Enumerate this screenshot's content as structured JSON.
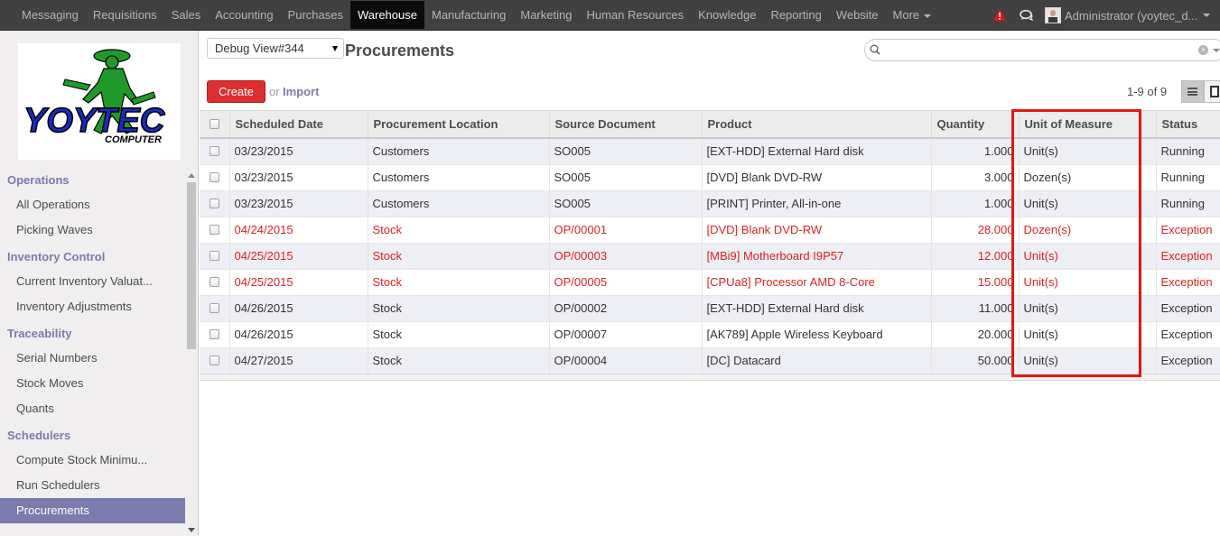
{
  "topbar": {
    "menu": [
      "Messaging",
      "Requisitions",
      "Sales",
      "Accounting",
      "Purchases",
      "Warehouse",
      "Manufacturing",
      "Marketing",
      "Human Resources",
      "Knowledge",
      "Reporting",
      "Website",
      "More"
    ],
    "active": "Warehouse",
    "user_name": "Administrator (yoytec_d..."
  },
  "sidebar": {
    "logo_text": "YOYTEC",
    "logo_subtext": "COMPUTER",
    "sections": [
      {
        "title": "Operations",
        "items": [
          "All Operations",
          "Picking Waves"
        ]
      },
      {
        "title": "Inventory Control",
        "items": [
          "Current Inventory Valuat...",
          "Inventory Adjustments"
        ]
      },
      {
        "title": "Traceability",
        "items": [
          "Serial Numbers",
          "Stock Moves",
          "Quants"
        ]
      },
      {
        "title": "Schedulers",
        "items": [
          "Compute Stock Minimu...",
          "Run Schedulers",
          "Procurements"
        ]
      }
    ],
    "active_item": "Procurements"
  },
  "header": {
    "debug_view": "Debug View#344",
    "title": "Procurements",
    "search_placeholder": "",
    "create_label": "Create",
    "or_label": "or",
    "import_label": "Import",
    "pager": "1-9 of 9"
  },
  "table": {
    "columns": [
      "Scheduled Date",
      "Procurement Location",
      "Source Document",
      "Product",
      "Quantity",
      "Unit of Measure",
      "Status"
    ],
    "rows": [
      {
        "date": "03/23/2015",
        "location": "Customers",
        "source": "SO005",
        "product": "[EXT-HDD] External Hard disk",
        "qty": "1.000",
        "uom": "Unit(s)",
        "status": "Running",
        "red": false
      },
      {
        "date": "03/23/2015",
        "location": "Customers",
        "source": "SO005",
        "product": "[DVD] Blank DVD-RW",
        "qty": "3.000",
        "uom": "Dozen(s)",
        "status": "Running",
        "red": false
      },
      {
        "date": "03/23/2015",
        "location": "Customers",
        "source": "SO005",
        "product": "[PRINT] Printer, All-in-one",
        "qty": "1.000",
        "uom": "Unit(s)",
        "status": "Running",
        "red": false
      },
      {
        "date": "04/24/2015",
        "location": "Stock",
        "source": "OP/00001",
        "product": "[DVD] Blank DVD-RW",
        "qty": "28.000",
        "uom": "Dozen(s)",
        "status": "Exception",
        "red": true
      },
      {
        "date": "04/25/2015",
        "location": "Stock",
        "source": "OP/00003",
        "product": "[MBi9] Motherboard I9P57",
        "qty": "12.000",
        "uom": "Unit(s)",
        "status": "Exception",
        "red": true
      },
      {
        "date": "04/25/2015",
        "location": "Stock",
        "source": "OP/00005",
        "product": "[CPUa8] Processor AMD 8-Core",
        "qty": "15.000",
        "uom": "Unit(s)",
        "status": "Exception",
        "red": true
      },
      {
        "date": "04/26/2015",
        "location": "Stock",
        "source": "OP/00002",
        "product": "[EXT-HDD] External Hard disk",
        "qty": "11.000",
        "uom": "Unit(s)",
        "status": "Exception",
        "red": false
      },
      {
        "date": "04/26/2015",
        "location": "Stock",
        "source": "OP/00007",
        "product": "[AK789] Apple Wireless Keyboard",
        "qty": "20.000",
        "uom": "Unit(s)",
        "status": "Exception",
        "red": false
      },
      {
        "date": "04/27/2015",
        "location": "Stock",
        "source": "OP/00004",
        "product": "[DC] Datacard",
        "qty": "50.000",
        "uom": "Unit(s)",
        "status": "Exception",
        "red": false
      }
    ]
  },
  "colors": {
    "topbar_bg": "#414141",
    "accent": "#7c7bad",
    "create_button": "#dc2f2f",
    "exception_text": "#dd2222",
    "highlight_box": "#e21717"
  }
}
